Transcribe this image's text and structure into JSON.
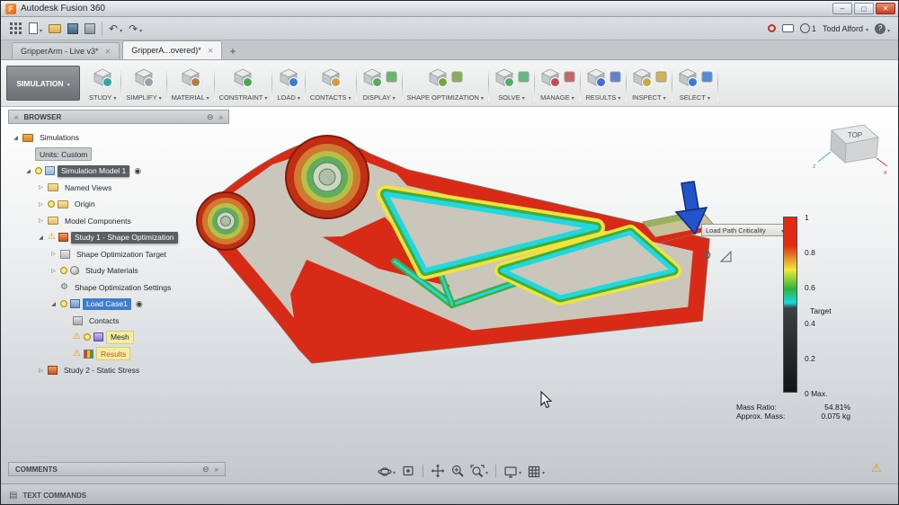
{
  "window": {
    "title": "Autodesk Fusion 360"
  },
  "qat": {
    "user": "Todd Alford",
    "notifications": "1",
    "icons": [
      "app-grid",
      "file-menu",
      "open",
      "save",
      "export",
      "undo",
      "redo",
      "record",
      "comment",
      "notifications",
      "help"
    ]
  },
  "tabs": {
    "items": [
      {
        "label": "GripperArm - Live v3*"
      },
      {
        "label": "GripperA...overed)*"
      }
    ],
    "add": "+"
  },
  "ribbon": {
    "workspace": "SIMULATION",
    "groups": [
      {
        "label": "STUDY",
        "accent": "#2fa8a0",
        "secondary": false
      },
      {
        "label": "SIMPLIFY",
        "accent": "#9aa0a6",
        "secondary": false
      },
      {
        "label": "MATERIAL",
        "accent": "#b5803f",
        "secondary": false
      },
      {
        "label": "CONSTRAINT",
        "accent": "#4aa84e",
        "secondary": false
      },
      {
        "label": "LOAD",
        "accent": "#3a7bd0",
        "secondary": false
      },
      {
        "label": "CONTACTS",
        "accent": "#d79b3a",
        "secondary": false
      },
      {
        "label": "DISPLAY",
        "accent": "#56ad56",
        "secondary": true
      },
      {
        "label": "SHAPE OPTIMIZATION",
        "accent": "#7aa23f",
        "secondary": true
      },
      {
        "label": "SOLVE",
        "accent": "#4fae68",
        "secondary": true
      },
      {
        "label": "MANAGE",
        "accent": "#c05050",
        "secondary": true
      },
      {
        "label": "RESULTS",
        "accent": "#4a6fc9",
        "secondary": true
      },
      {
        "label": "INSPECT",
        "accent": "#caa83a",
        "secondary": true
      },
      {
        "label": "SELECT",
        "accent": "#3a7bd0",
        "secondary": true
      }
    ]
  },
  "browser": {
    "header": "BROWSER",
    "tree": [
      {
        "label": "Simulations",
        "level": 0,
        "arrow": "expanded",
        "icons": [
          "folder-orange"
        ],
        "style": null,
        "trailing": null
      },
      {
        "label": "Units: Custom",
        "level": 1,
        "arrow": "none",
        "icons": [],
        "style": "badge",
        "trailing": null
      },
      {
        "label": "Simulation Model 1",
        "level": 1,
        "arrow": "expanded",
        "icons": [
          "bulb",
          "box-blue"
        ],
        "style": "seldark",
        "trailing": "eye"
      },
      {
        "label": "Named Views",
        "level": 2,
        "arrow": "collapsed",
        "icons": [
          "folder"
        ],
        "style": null,
        "trailing": null
      },
      {
        "label": "Origin",
        "level": 2,
        "arrow": "collapsed",
        "icons": [
          "bulb",
          "folder"
        ],
        "style": null,
        "trailing": null
      },
      {
        "label": "Model Components",
        "level": 2,
        "arrow": "collapsed",
        "icons": [
          "folder"
        ],
        "style": null,
        "trailing": null
      },
      {
        "label": "Study 1 - Shape Optimization",
        "level": 2,
        "arrow": "expanded",
        "icons": [
          "warning",
          "study"
        ],
        "style": "seldark",
        "trailing": null
      },
      {
        "label": "Shape Optimization Target",
        "level": 3,
        "arrow": "collapsed",
        "icons": [
          "target"
        ],
        "style": null,
        "trailing": null
      },
      {
        "label": "Study Materials",
        "level": 3,
        "arrow": "collapsed",
        "icons": [
          "bulb",
          "material"
        ],
        "style": null,
        "trailing": null
      },
      {
        "label": "Shape Optimization Settings",
        "level": 3,
        "arrow": "none",
        "icons": [
          "settings"
        ],
        "style": null,
        "trailing": null
      },
      {
        "label": "Load Case1",
        "level": 3,
        "arrow": "expanded",
        "icons": [
          "bulb",
          "load"
        ],
        "style": "selblue",
        "trailing": "eye"
      },
      {
        "label": "Contacts",
        "level": 4,
        "arrow": "none",
        "icons": [
          "contacts"
        ],
        "style": null,
        "trailing": null
      },
      {
        "label": "Mesh",
        "level": 4,
        "arrow": "none",
        "icons": [
          "warning",
          "bulb",
          "mesh"
        ],
        "style": "warnbg",
        "trailing": null
      },
      {
        "label": "Results",
        "level": 4,
        "arrow": "none",
        "icons": [
          "warning",
          "results"
        ],
        "style": "warnbg-orange",
        "trailing": null
      },
      {
        "label": "Study 2 - Static Stress",
        "level": 2,
        "arrow": "collapsed",
        "icons": [
          "study"
        ],
        "style": null,
        "trailing": null
      }
    ]
  },
  "viewport": {
    "viewcube": {
      "label": "TOP",
      "axis_z": "z",
      "axis_x": "x"
    },
    "load_path": {
      "label": "Load Path Criticality"
    },
    "legend": {
      "ticks": [
        "1",
        "0.8",
        "0.6",
        "0.4",
        "0.2",
        "0 Max."
      ],
      "target_label": "Target",
      "target_value": 0.47,
      "colors": [
        "#e02a12 0%",
        "#e02a12 16%",
        "#f0e83a 30%",
        "#2eb43c 41%",
        "#17d8e0 49%",
        "#3c4040 52%",
        "#141414 100%"
      ]
    },
    "mass": {
      "rows": [
        {
          "label": "Mass Ratio:",
          "value": "54.81%"
        },
        {
          "label": "Approx. Mass:",
          "value": "0.075 kg"
        }
      ]
    }
  },
  "navbar": {
    "items": [
      {
        "name": "orbit",
        "caret": true,
        "divider_after": false
      },
      {
        "name": "look-at",
        "caret": false,
        "divider_after": true
      },
      {
        "name": "pan",
        "caret": false,
        "divider_after": false
      },
      {
        "name": "zoom",
        "caret": false,
        "divider_after": false
      },
      {
        "name": "fit",
        "caret": true,
        "divider_after": true
      },
      {
        "name": "display-settings",
        "caret": true,
        "divider_after": false
      },
      {
        "name": "grid-display",
        "caret": true,
        "divider_after": false
      }
    ]
  },
  "comments": {
    "label": "COMMENTS"
  },
  "statusbar": {
    "label": "TEXT COMMANDS"
  }
}
